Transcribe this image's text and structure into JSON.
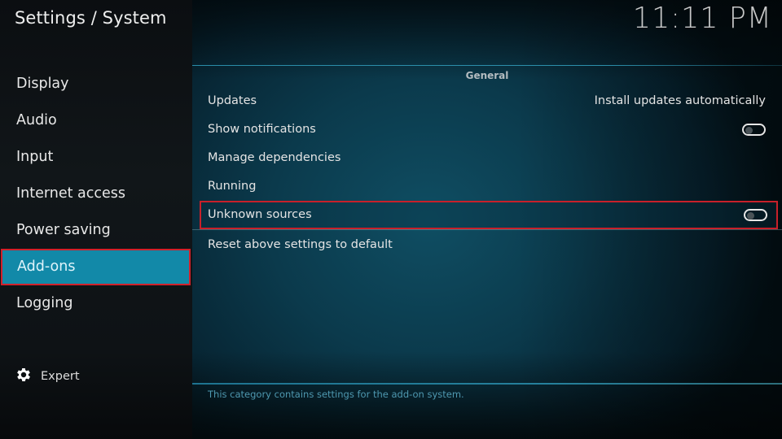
{
  "header": {
    "title": "Settings / System",
    "clock": "11:11 PM"
  },
  "sidebar": {
    "items": [
      {
        "label": "Display",
        "selected": false
      },
      {
        "label": "Audio",
        "selected": false
      },
      {
        "label": "Input",
        "selected": false
      },
      {
        "label": "Internet access",
        "selected": false
      },
      {
        "label": "Power saving",
        "selected": false
      },
      {
        "label": "Add-ons",
        "selected": true
      },
      {
        "label": "Logging",
        "selected": false
      }
    ],
    "settings_level": {
      "icon": "gear-icon",
      "label": "Expert"
    }
  },
  "main": {
    "group_header": "General",
    "settings": [
      {
        "label": "Updates",
        "value": "Install updates automatically"
      },
      {
        "label": "Show notifications",
        "toggle": false
      },
      {
        "label": "Manage dependencies"
      },
      {
        "label": "Running"
      },
      {
        "label": "Unknown sources",
        "toggle": false,
        "highlighted": true
      }
    ],
    "reset_label": "Reset above settings to default",
    "description": "This category contains settings for the add-on system."
  },
  "colors": {
    "selected_item_bg": "#1289a8",
    "highlight_border": "#d2202a",
    "description_text": "#4e98b0"
  }
}
